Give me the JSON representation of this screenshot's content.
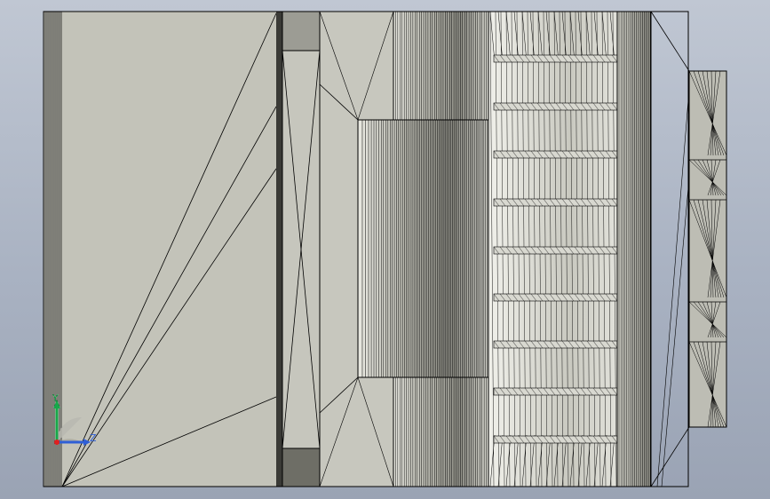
{
  "viewport": {
    "background_top": "#c0c7d3",
    "background_bottom": "#9aa3b4"
  },
  "model": {
    "face_color": "#c3c3b9",
    "edge_color": "#000000",
    "highlight_color": "#f2f2ea",
    "shadow_color": "#6a6a62"
  },
  "triad": {
    "y_label": "Y",
    "z_label": "Z",
    "y_color": "#17a84a",
    "z_color": "#2f5fd6",
    "x_color": "#e02020"
  }
}
